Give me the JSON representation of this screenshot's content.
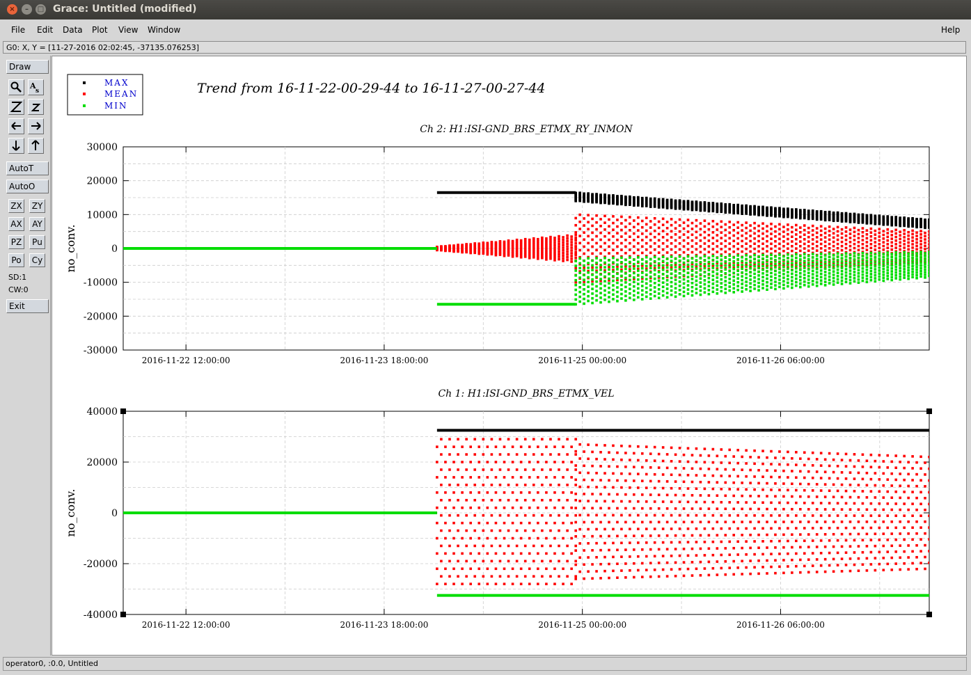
{
  "window": {
    "title": "Grace: Untitled (modified)",
    "close_glyph": "×",
    "min_glyph": "–",
    "max_glyph": "□"
  },
  "menu": {
    "file": "File",
    "edit": "Edit",
    "data": "Data",
    "plot": "Plot",
    "view": "View",
    "window": "Window",
    "help": "Help"
  },
  "coord_readout": "G0: X, Y = [11-27-2016 02:02:45, -37135.076253]",
  "toolbar": {
    "draw": "Draw",
    "autot": "AutoT",
    "autoo": "AutoO",
    "exit": "Exit",
    "zx": "ZX",
    "zy": "ZY",
    "ax": "AX",
    "ay": "AY",
    "pz": "PZ",
    "pu": "Pu",
    "po": "Po",
    "cy": "Cy",
    "sd": "SD:1",
    "cw": "CW:0"
  },
  "status": "operator0, :0.0, Untitled",
  "plot": {
    "title": "Trend from 16-11-22-00-29-44 to 16-11-27-00-27-44",
    "legend": [
      {
        "label": "MAX",
        "color": "#000000"
      },
      {
        "label": "MEAN",
        "color": "#ff0000"
      },
      {
        "label": "MIN",
        "color": "#00dd00"
      }
    ],
    "legend_text_color": "#0000cc"
  },
  "chart_data": [
    {
      "type": "scatter",
      "title": "Ch 2: H1:ISI-GND_BRS_ETMX_RY_INMON",
      "xlabel": "",
      "ylabel": "no_conv.",
      "ylim": [
        -30000,
        30000
      ],
      "yticks": [
        "30000",
        "20000",
        "10000",
        "0",
        "-10000",
        "-20000",
        "-30000"
      ],
      "xticks": [
        "2016-11-22 12:00:00",
        "2016-11-23 18:00:00",
        "2016-11-25 00:00:00",
        "2016-11-26 06:00:00"
      ],
      "xlim_hours_from_2016-11-22": [
        2.5,
        124.5
      ],
      "grid": true,
      "series": [
        {
          "name": "MAX",
          "color": "#000000",
          "segments": [
            {
              "t0": 2.5,
              "t1": 50,
              "lo": 0,
              "hi": 0
            },
            {
              "t0": 50,
              "t1": 71,
              "lo": 16500,
              "hi": 16500
            },
            {
              "t0": 71,
              "t1": 124.5,
              "lo": 14000,
              "hi": 16500,
              "lo_end": 6000,
              "hi_end": 8500
            }
          ]
        },
        {
          "name": "MEAN",
          "color": "#ff0000",
          "segments": [
            {
              "t0": 2.5,
              "t1": 50,
              "lo": 0,
              "hi": 0
            },
            {
              "t0": 50,
              "t1": 71,
              "lo": -500,
              "hi": 500,
              "lo_end": -4000,
              "hi_end": 4000
            },
            {
              "t0": 71,
              "t1": 124.5,
              "lo": -10000,
              "hi": 10000,
              "lo_end": -4000,
              "hi_end": 5000
            }
          ]
        },
        {
          "name": "MIN",
          "color": "#00dd00",
          "segments": [
            {
              "t0": 2.5,
              "t1": 50,
              "lo": 0,
              "hi": 0
            },
            {
              "t0": 50,
              "t1": 71,
              "lo": -16500,
              "hi": -16500
            },
            {
              "t0": 71,
              "t1": 124.5,
              "lo": -16500,
              "hi": -3000,
              "lo_end": -8500,
              "hi_end": -1000
            }
          ]
        }
      ]
    },
    {
      "type": "scatter",
      "title": "Ch 1: H1:ISI-GND_BRS_ETMX_VEL",
      "xlabel": "",
      "ylabel": "no_conv.",
      "ylim": [
        -40000,
        40000
      ],
      "yticks": [
        "40000",
        "20000",
        "0",
        "-20000",
        "-40000"
      ],
      "xticks": [
        "2016-11-22 12:00:00",
        "2016-11-23 18:00:00",
        "2016-11-25 00:00:00",
        "2016-11-26 06:00:00"
      ],
      "xlim_hours_from_2016-11-22": [
        2.5,
        124.5
      ],
      "grid": true,
      "series": [
        {
          "name": "MAX",
          "color": "#000000",
          "segments": [
            {
              "t0": 2.5,
              "t1": 50,
              "lo": 0,
              "hi": 0
            },
            {
              "t0": 50,
              "t1": 124.5,
              "lo": 32500,
              "hi": 32500
            }
          ]
        },
        {
          "name": "MEAN",
          "color": "#ff0000",
          "segments": [
            {
              "t0": 2.5,
              "t1": 50,
              "lo": 0,
              "hi": 0
            },
            {
              "t0": 50,
              "t1": 71,
              "lo": -28000,
              "hi": 29000
            },
            {
              "t0": 71,
              "t1": 124.5,
              "lo": -26000,
              "hi": 27000,
              "lo_end": -22000,
              "hi_end": 22000
            }
          ]
        },
        {
          "name": "MIN",
          "color": "#00dd00",
          "segments": [
            {
              "t0": 2.5,
              "t1": 50,
              "lo": 0,
              "hi": 0
            },
            {
              "t0": 50,
              "t1": 124.5,
              "lo": -32500,
              "hi": -32500
            }
          ]
        }
      ]
    }
  ]
}
